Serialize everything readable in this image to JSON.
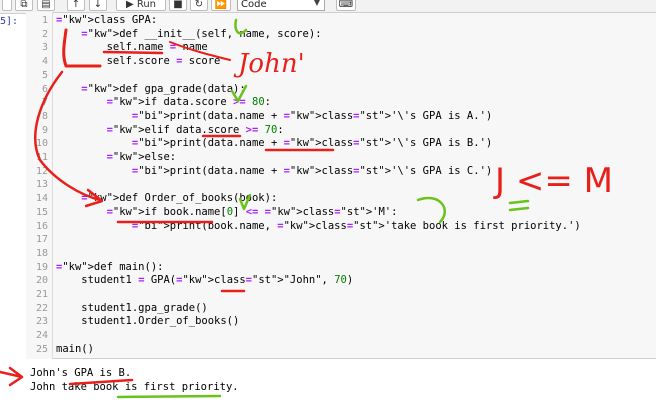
{
  "toolbar": {
    "run_label": "Run",
    "cell_type": "Code"
  },
  "cell": {
    "prompt": "5]:",
    "lines": [
      {
        "n": "1",
        "text": "class GPA:"
      },
      {
        "n": "2",
        "text": "    def __init__(self, name, score):"
      },
      {
        "n": "3",
        "text": "        self.name = name"
      },
      {
        "n": "4",
        "text": "        self.score = score"
      },
      {
        "n": "5",
        "text": ""
      },
      {
        "n": "6",
        "text": "    def gpa_grade(data):"
      },
      {
        "n": "7",
        "text": "        if data.score >= 80:"
      },
      {
        "n": "8",
        "text": "            print(data.name + '\\'s GPA is A.')"
      },
      {
        "n": "9",
        "text": "        elif data.score >= 70:"
      },
      {
        "n": "10",
        "text": "            print(data.name + '\\'s GPA is B.')"
      },
      {
        "n": "11",
        "text": "        else:"
      },
      {
        "n": "12",
        "text": "            print(data.name + '\\'s GPA is C.')"
      },
      {
        "n": "13",
        "text": ""
      },
      {
        "n": "14",
        "text": "    def Order_of_books(book):"
      },
      {
        "n": "15",
        "text": "        if book.name[0] <= 'M':"
      },
      {
        "n": "16",
        "text": "            print(book.name, 'take book is first priority.')"
      },
      {
        "n": "17",
        "text": ""
      },
      {
        "n": "18",
        "text": ""
      },
      {
        "n": "19",
        "text": "def main():"
      },
      {
        "n": "20",
        "text": "    student1 = GPA(\"John\", 70)"
      },
      {
        "n": "21",
        "text": ""
      },
      {
        "n": "22",
        "text": "    student1.gpa_grade()"
      },
      {
        "n": "23",
        "text": "    student1.Order_of_books()"
      },
      {
        "n": "24",
        "text": ""
      },
      {
        "n": "25",
        "text": "main()"
      }
    ]
  },
  "output": [
    "John's GPA is B.",
    "John take book is first priority."
  ],
  "annotations": {
    "john_note": "John'",
    "comparison_note": "J <= M",
    "ink_red": "#e8201c",
    "ink_green": "#6ac21c"
  }
}
